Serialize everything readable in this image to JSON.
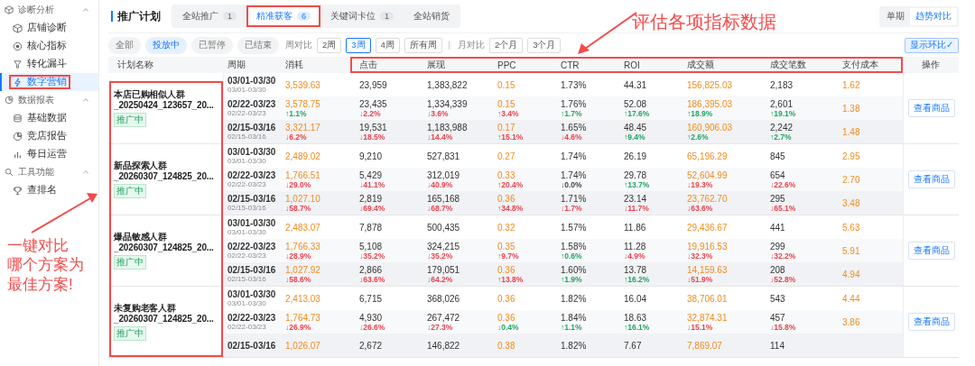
{
  "sidebar": {
    "groups": [
      {
        "label": "诊断分析",
        "expanded": true,
        "items": [
          {
            "label": "店铺诊断",
            "selected": false
          },
          {
            "label": "核心指标",
            "selected": false
          },
          {
            "label": "转化漏斗",
            "selected": false
          },
          {
            "label": "数字营销",
            "selected": true
          }
        ]
      },
      {
        "label": "数据报表",
        "expanded": true,
        "items": [
          {
            "label": "基础数据",
            "selected": false
          },
          {
            "label": "竞店报告",
            "selected": false
          },
          {
            "label": "每日运营",
            "selected": false
          }
        ]
      },
      {
        "label": "工具功能",
        "expanded": true,
        "items": [
          {
            "label": "查排名",
            "selected": false
          }
        ]
      }
    ]
  },
  "header": {
    "title": "推广计划",
    "tabs": [
      {
        "label": "全站推广",
        "count": "1",
        "selected": false
      },
      {
        "label": "精准获客",
        "count": "6",
        "selected": true
      },
      {
        "label": "关键词卡位",
        "count": "1",
        "selected": false
      },
      {
        "label": "全站销货",
        "selected": false
      }
    ],
    "view_toggle": [
      {
        "label": "单期",
        "selected": false
      },
      {
        "label": "趋势对比",
        "selected": true
      }
    ]
  },
  "filters": {
    "status": [
      {
        "label": "全部",
        "selected": false
      },
      {
        "label": "投放中",
        "selected": true
      },
      {
        "label": "已暂停",
        "selected": false
      },
      {
        "label": "已结束",
        "selected": false
      }
    ],
    "week_label": "周对比",
    "weeks": [
      {
        "label": "2周",
        "selected": false
      },
      {
        "label": "3周",
        "selected": true
      },
      {
        "label": "4周",
        "selected": false
      },
      {
        "label": "所有周",
        "selected": false
      }
    ],
    "month_label": "月对比",
    "months": [
      {
        "label": "2个月",
        "selected": false
      },
      {
        "label": "3个月",
        "selected": false
      }
    ],
    "compare_toggle": {
      "label": "显示环比✓",
      "on": true
    }
  },
  "table": {
    "columns": [
      {
        "label": "计划名称"
      },
      {
        "label": "周期"
      },
      {
        "label": "消耗",
        "highlight": true
      },
      {
        "label": "点击"
      },
      {
        "label": "展现"
      },
      {
        "label": "PPC",
        "highlight": true
      },
      {
        "label": "CTR"
      },
      {
        "label": "ROI"
      },
      {
        "label": "成交额",
        "highlight": true
      },
      {
        "label": "成交笔数"
      },
      {
        "label": "支付成本",
        "highlight": true
      },
      {
        "label": "操作"
      }
    ],
    "plans": [
      {
        "name": "本店已购相似人群_20250424_123657_20...",
        "status": "推广中",
        "action": "查看商品",
        "rows": [
          {
            "period": "03/01-03/30",
            "period_sub": "03/01-03/30",
            "cells": [
              {
                "value": "3,539.63"
              },
              {
                "value": "23,959"
              },
              {
                "value": "1,383,822"
              },
              {
                "value": "0.15"
              },
              {
                "value": "1.73%"
              },
              {
                "value": "44.31"
              },
              {
                "value": "156,825.03"
              },
              {
                "value": "2,183"
              },
              {
                "value": "1.62"
              }
            ]
          },
          {
            "period": "02/22-03/23",
            "period_sub": "02/22-03/23",
            "cells": [
              {
                "value": "3,578.75",
                "change": "↑1.1%",
                "color": "#20a464"
              },
              {
                "value": "23,435",
                "change": "↓2.2%",
                "color": "#e8424c"
              },
              {
                "value": "1,334,339",
                "change": "↓3.6%",
                "color": "#e8424c"
              },
              {
                "value": "0.15",
                "change": "↑3.4%",
                "color": "#e8424c"
              },
              {
                "value": "1.76%",
                "change": "↑1.7%",
                "color": "#20a464"
              },
              {
                "value": "52.08",
                "change": "↑17.6%",
                "color": "#20a464"
              },
              {
                "value": "186,395.03",
                "change": "↑18.9%",
                "color": "#20a464"
              },
              {
                "value": "2,601",
                "change": "↑19.1%",
                "color": "#20a464"
              },
              {
                "value": "1.38"
              }
            ]
          },
          {
            "period": "02/15-03/16",
            "period_sub": "02/15-03/16",
            "cells": [
              {
                "value": "3,321.17",
                "change": "↓6.2%",
                "color": "#e8424c"
              },
              {
                "value": "19,531",
                "change": "↓18.5%",
                "color": "#e8424c"
              },
              {
                "value": "1,183,988",
                "change": "↓14.4%",
                "color": "#e8424c"
              },
              {
                "value": "0.17",
                "change": "↑15.1%",
                "color": "#e8424c"
              },
              {
                "value": "1.65%",
                "change": "↓4.6%",
                "color": "#e8424c"
              },
              {
                "value": "48.45",
                "change": "↑9.4%",
                "color": "#20a464"
              },
              {
                "value": "160,906.03",
                "change": "↑2.6%",
                "color": "#20a464"
              },
              {
                "value": "2,242",
                "change": "↑2.7%",
                "color": "#20a464"
              },
              {
                "value": "1.48"
              }
            ]
          }
        ]
      },
      {
        "name": "新品探索人群_20260307_124825_20...",
        "status": "推广中",
        "action": "查看商品",
        "rows": [
          {
            "period": "03/01-03/30",
            "period_sub": "03/01-03/30",
            "cells": [
              {
                "value": "2,489.02"
              },
              {
                "value": "9,210"
              },
              {
                "value": "527,831"
              },
              {
                "value": "0.27"
              },
              {
                "value": "1.74%"
              },
              {
                "value": "26.19"
              },
              {
                "value": "65,196.29"
              },
              {
                "value": "845"
              },
              {
                "value": "2.95"
              }
            ]
          },
          {
            "period": "02/22-03/23",
            "period_sub": "02/22-03/23",
            "cells": [
              {
                "value": "1,766.51",
                "change": "↓29.0%",
                "color": "#e8424c"
              },
              {
                "value": "5,429",
                "change": "↓41.1%",
                "color": "#e8424c"
              },
              {
                "value": "312,019",
                "change": "↓40.9%",
                "color": "#e8424c"
              },
              {
                "value": "0.33",
                "change": "↑20.4%",
                "color": "#e8424c"
              },
              {
                "value": "1.74%",
                "change": "↓0.0%",
                "color": "#444444"
              },
              {
                "value": "29.78",
                "change": "↑13.7%",
                "color": "#20a464"
              },
              {
                "value": "52,604.99",
                "change": "↓19.3%",
                "color": "#e8424c"
              },
              {
                "value": "654",
                "change": "↓22.6%",
                "color": "#e8424c"
              },
              {
                "value": "2.70"
              }
            ]
          },
          {
            "period": "02/15-03/16",
            "period_sub": "02/15-03/16",
            "cells": [
              {
                "value": "1,027.10",
                "change": "↓58.7%",
                "color": "#e8424c"
              },
              {
                "value": "2,819",
                "change": "↓69.4%",
                "color": "#e8424c"
              },
              {
                "value": "165,168",
                "change": "↓68.7%",
                "color": "#e8424c"
              },
              {
                "value": "0.36",
                "change": "↑34.8%",
                "color": "#e8424c"
              },
              {
                "value": "1.71%",
                "change": "↓1.7%",
                "color": "#e8424c"
              },
              {
                "value": "23.14",
                "change": "↓11.7%",
                "color": "#e8424c"
              },
              {
                "value": "23,762.70",
                "change": "↓63.6%",
                "color": "#e8424c"
              },
              {
                "value": "295",
                "change": "↓65.1%",
                "color": "#e8424c"
              },
              {
                "value": "3.48"
              }
            ]
          }
        ]
      },
      {
        "name": "爆品敏感人群_20260307_124825_20...",
        "status": "推广中",
        "action": "查看商品",
        "rows": [
          {
            "period": "03/01-03/30",
            "period_sub": "03/01-03/30",
            "cells": [
              {
                "value": "2,483.07"
              },
              {
                "value": "7,878"
              },
              {
                "value": "500,435"
              },
              {
                "value": "0.32"
              },
              {
                "value": "1.57%"
              },
              {
                "value": "11.86"
              },
              {
                "value": "29,436.67"
              },
              {
                "value": "441"
              },
              {
                "value": "5.63"
              }
            ]
          },
          {
            "period": "02/22-03/23",
            "period_sub": "02/22-03/23",
            "cells": [
              {
                "value": "1,766.33",
                "change": "↓28.9%",
                "color": "#e8424c"
              },
              {
                "value": "5,108",
                "change": "↓35.2%",
                "color": "#e8424c"
              },
              {
                "value": "324,215",
                "change": "↓35.2%",
                "color": "#e8424c"
              },
              {
                "value": "0.35",
                "change": "↑9.7%",
                "color": "#e8424c"
              },
              {
                "value": "1.58%",
                "change": "↑0.6%",
                "color": "#20a464"
              },
              {
                "value": "11.28",
                "change": "↓4.9%",
                "color": "#e8424c"
              },
              {
                "value": "19,916.53",
                "change": "↓32.3%",
                "color": "#e8424c"
              },
              {
                "value": "299",
                "change": "↓32.2%",
                "color": "#e8424c"
              },
              {
                "value": "5.91"
              }
            ]
          },
          {
            "period": "02/15-03/16",
            "period_sub": "02/15-03/16",
            "cells": [
              {
                "value": "1,027.92",
                "change": "↓58.6%",
                "color": "#e8424c"
              },
              {
                "value": "2,866",
                "change": "↓63.6%",
                "color": "#e8424c"
              },
              {
                "value": "179,051",
                "change": "↓64.2%",
                "color": "#e8424c"
              },
              {
                "value": "0.36",
                "change": "↑13.8%",
                "color": "#e8424c"
              },
              {
                "value": "1.60%",
                "change": "↑1.9%",
                "color": "#20a464"
              },
              {
                "value": "13.78",
                "change": "↑16.2%",
                "color": "#20a464"
              },
              {
                "value": "14,159.63",
                "change": "↓51.9%",
                "color": "#e8424c"
              },
              {
                "value": "208",
                "change": "↓52.8%",
                "color": "#e8424c"
              },
              {
                "value": "4.94"
              }
            ]
          }
        ]
      },
      {
        "name": "未复购老客人群_20260307_124825_20...",
        "status": "推广中",
        "action": "查看商品",
        "rows": [
          {
            "period": "03/01-03/30",
            "period_sub": "03/01-03/30",
            "cells": [
              {
                "value": "2,413.03"
              },
              {
                "value": "6,715"
              },
              {
                "value": "368,026"
              },
              {
                "value": "0.36"
              },
              {
                "value": "1.82%"
              },
              {
                "value": "16.04"
              },
              {
                "value": "38,706.01"
              },
              {
                "value": "543"
              },
              {
                "value": "4.44"
              }
            ]
          },
          {
            "period": "02/22-03/23",
            "period_sub": "02/22-03/23",
            "cells": [
              {
                "value": "1,764.73",
                "change": "↓26.9%",
                "color": "#e8424c"
              },
              {
                "value": "4,930",
                "change": "↓26.6%",
                "color": "#e8424c"
              },
              {
                "value": "267,472",
                "change": "↓27.3%",
                "color": "#e8424c"
              },
              {
                "value": "0.36",
                "change": "↓0.4%",
                "color": "#20a464"
              },
              {
                "value": "1.84%",
                "change": "↑1.1%",
                "color": "#20a464"
              },
              {
                "value": "18.63",
                "change": "↑16.1%",
                "color": "#20a464"
              },
              {
                "value": "32,874.31",
                "change": "↓15.1%",
                "color": "#e8424c"
              },
              {
                "value": "457",
                "change": "↓15.8%",
                "color": "#e8424c"
              },
              {
                "value": "3.86"
              }
            ]
          },
          {
            "period": "02/15-03/16",
            "cells": [
              {
                "value": "1,026.07"
              },
              {
                "value": "2,672"
              },
              {
                "value": "146,822"
              },
              {
                "value": "0.38"
              },
              {
                "value": "1.82%"
              },
              {
                "value": "7.67"
              },
              {
                "value": "7,869.07"
              },
              {
                "value": "114"
              },
              {}
            ]
          }
        ]
      }
    ]
  },
  "annotations": [
    {
      "kind": "callout",
      "lines": [
        "评估各项指标数据"
      ]
    },
    {
      "kind": "callout",
      "lines": [
        "一键对比",
        "哪个方案为",
        "最佳方案!"
      ]
    }
  ]
}
